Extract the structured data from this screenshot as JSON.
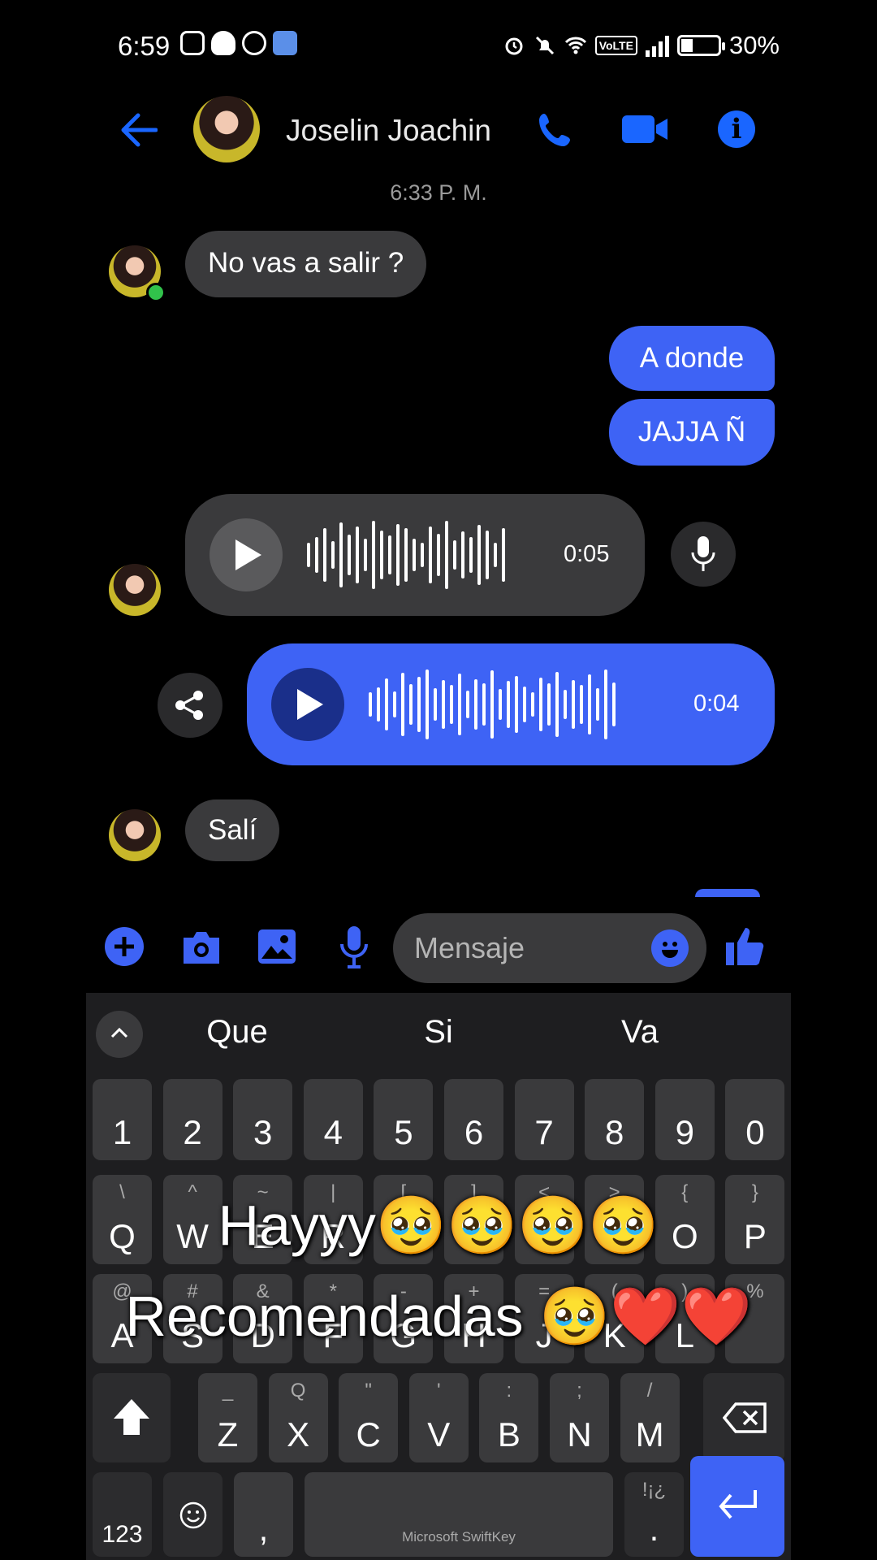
{
  "status_bar": {
    "time": "6:59",
    "network": "VoLTE",
    "battery": "30%"
  },
  "header": {
    "contact_name": "Joselin Joachin"
  },
  "conversation": {
    "timestamp": "6:33 P. M.",
    "messages": [
      {
        "sender": "contact",
        "text": "No vas a salir ?"
      },
      {
        "sender": "me",
        "text": "A donde"
      },
      {
        "sender": "me",
        "text": "JAJJA Ñ"
      },
      {
        "sender": "contact",
        "type": "audio",
        "duration": "0:05"
      },
      {
        "sender": "me",
        "type": "audio",
        "duration": "0:04"
      },
      {
        "sender": "contact",
        "text": "Salí"
      }
    ]
  },
  "composer": {
    "placeholder": "Mensaje"
  },
  "keyboard": {
    "suggestions": [
      "Que",
      "Si",
      "Va"
    ],
    "number_row": [
      "1",
      "2",
      "3",
      "4",
      "5",
      "6",
      "7",
      "8",
      "9",
      "0"
    ],
    "row1": [
      {
        "k": "Q",
        "s": "\\"
      },
      {
        "k": "W",
        "s": "^"
      },
      {
        "k": "E",
        "s": "~"
      },
      {
        "k": "R",
        "s": "|"
      },
      {
        "k": "T",
        "s": "["
      },
      {
        "k": "Y",
        "s": "]"
      },
      {
        "k": "U",
        "s": "<"
      },
      {
        "k": "I",
        "s": ">"
      },
      {
        "k": "O",
        "s": "{"
      },
      {
        "k": "P",
        "s": "}"
      }
    ],
    "row2": [
      {
        "k": "A",
        "s": "@"
      },
      {
        "k": "S",
        "s": "#"
      },
      {
        "k": "D",
        "s": "&"
      },
      {
        "k": "F",
        "s": "*"
      },
      {
        "k": "G",
        "s": "-"
      },
      {
        "k": "H",
        "s": "+"
      },
      {
        "k": "J",
        "s": "="
      },
      {
        "k": "K",
        "s": "("
      },
      {
        "k": "L",
        "s": ")"
      }
    ],
    "row2_extra_sub": "%",
    "row3": [
      {
        "k": "Z",
        "s": "_"
      },
      {
        "k": "X",
        "s": "Q"
      },
      {
        "k": "C",
        "s": "\""
      },
      {
        "k": "V",
        "s": "'"
      },
      {
        "k": "B",
        "s": ":"
      },
      {
        "k": "N",
        "s": ";"
      },
      {
        "k": "M",
        "s": "/"
      }
    ],
    "numbers_key": "123",
    "comma_key": ",",
    "space_label": "Microsoft SwiftKey",
    "period_sub": "!¡¿",
    "period_key": "."
  },
  "overlay_caption": {
    "line1": "Hayyy🥹🥹🥹🥹",
    "line2": "Recomendadas 🥹❤️❤️"
  },
  "colors": {
    "accent": "#3e63f5",
    "icon_blue": "#1a66ff",
    "incoming_bubble": "#3a3a3c",
    "background": "#000000"
  }
}
